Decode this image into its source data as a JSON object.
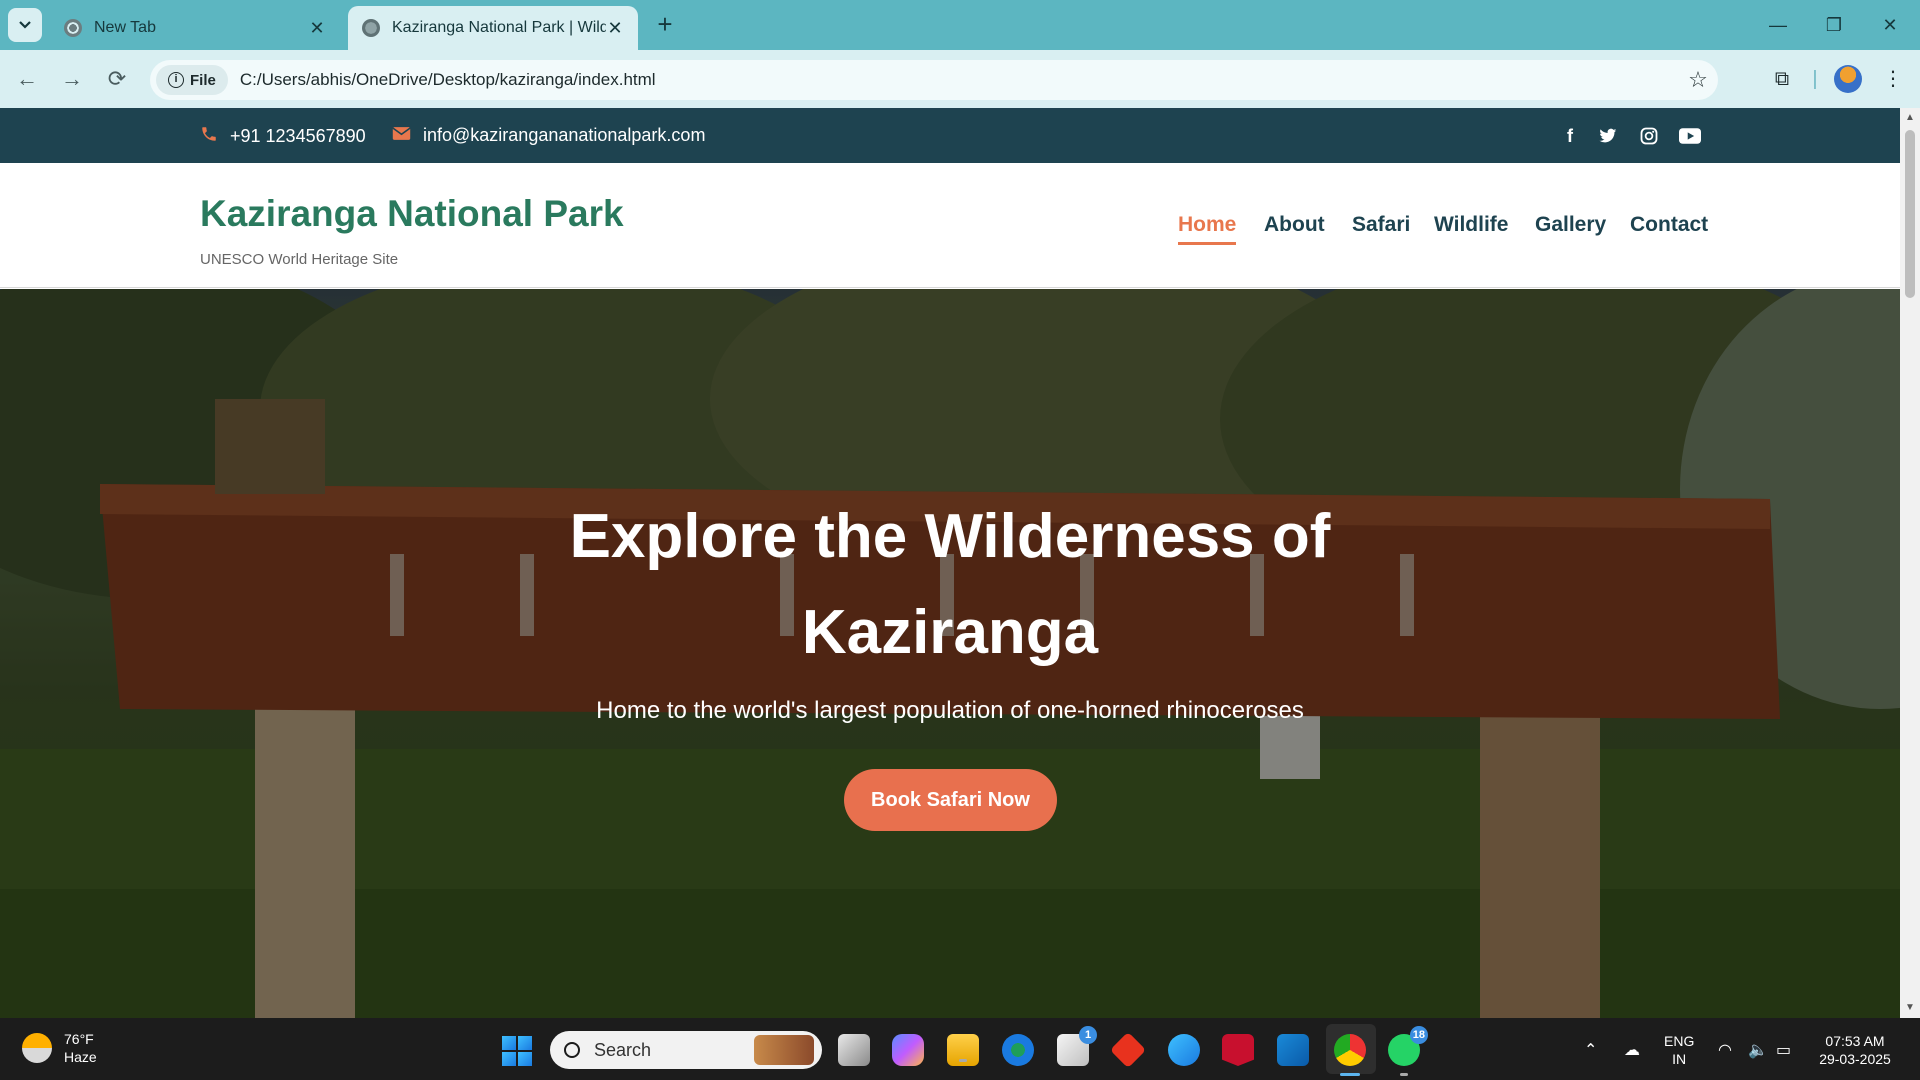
{
  "browser": {
    "tabs": [
      {
        "title": "New Tab",
        "active": false
      },
      {
        "title": "Kaziranga National Park | Wildlife",
        "active": true
      }
    ],
    "address": {
      "chip_label": "File",
      "url": "C:/Users/abhis/OneDrive/Desktop/kaziranga/index.html"
    }
  },
  "site": {
    "topbar": {
      "phone": "+91 1234567890",
      "email": "info@kazirangananationalpark.com",
      "social_icons": [
        "facebook-icon",
        "twitter-icon",
        "instagram-icon",
        "youtube-icon"
      ]
    },
    "brand": {
      "name": "Kaziranga National Park",
      "tagline": "UNESCO World Heritage Site"
    },
    "nav": [
      {
        "label": "Home",
        "active": true
      },
      {
        "label": "About",
        "active": false
      },
      {
        "label": "Safari",
        "active": false
      },
      {
        "label": "Wildlife",
        "active": false
      },
      {
        "label": "Gallery",
        "active": false
      },
      {
        "label": "Contact",
        "active": false
      }
    ],
    "hero": {
      "title_line1": "Explore the Wilderness of",
      "title_line2": "Kaziranga",
      "subtitle": "Home to the world's largest population of one-horned rhinoceroses",
      "cta": "Book Safari Now"
    }
  },
  "taskbar": {
    "weather": {
      "temp": "76°F",
      "condition": "Haze"
    },
    "search_placeholder": "Search",
    "badges": {
      "store": "1",
      "whatsapp": "18"
    },
    "language": {
      "line1": "ENG",
      "line2": "IN"
    },
    "clock": {
      "time": "07:53 AM",
      "date": "29-03-2025"
    }
  },
  "colors": {
    "accent": "#e8774d",
    "brand_green": "#2a7a5e",
    "topbar_bg": "#1e4350",
    "browser_frame": "#5cb6c1"
  }
}
